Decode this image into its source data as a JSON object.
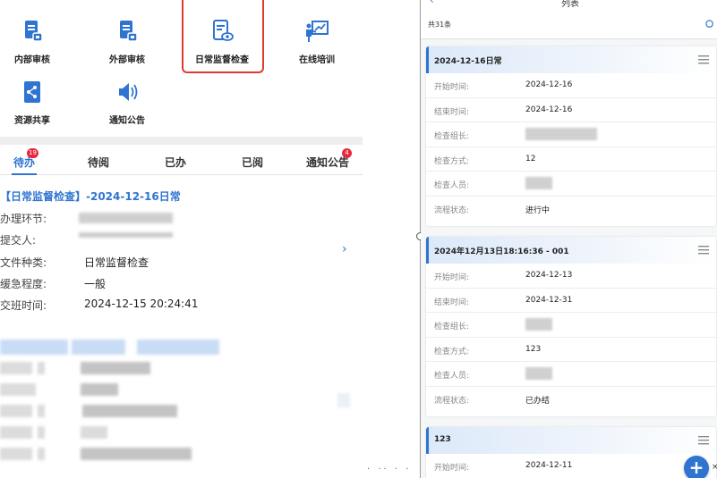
{
  "left": {
    "tiles": [
      {
        "label": "内部审核",
        "icon": "document-audit-icon"
      },
      {
        "label": "外部审核",
        "icon": "document-audit-icon"
      },
      {
        "label": "日常监督检查",
        "icon": "document-inspect-icon"
      },
      {
        "label": "在线培训",
        "icon": "presentation-board-icon"
      },
      {
        "label": "资源共享",
        "icon": "share-icon"
      },
      {
        "label": "通知公告",
        "icon": "megaphone-icon"
      }
    ],
    "tabs": [
      {
        "label": "待办",
        "badge": "19"
      },
      {
        "label": "待阅",
        "badge": ""
      },
      {
        "label": "已办",
        "badge": ""
      },
      {
        "label": "已阅",
        "badge": ""
      },
      {
        "label": "通知公告",
        "badge": "4"
      }
    ],
    "task": {
      "title": "【日常监督检查】-2024-12-16日常",
      "fields": [
        {
          "label": "办理环节:",
          "value": ""
        },
        {
          "label": "提交人:",
          "value": ""
        },
        {
          "label": "文件种类:",
          "value": "日常监督检查"
        },
        {
          "label": "缓急程度:",
          "value": "一般"
        },
        {
          "label": "交班时间:",
          "value": "2024-12-15 20:24:41"
        }
      ]
    }
  },
  "right": {
    "nav_title": "列表",
    "count_text": "共31条",
    "fab_label": "+",
    "close_glyph": "×",
    "cards": [
      {
        "title": "2024-12-16日常",
        "fields": [
          {
            "label": "开始时间:",
            "value": "2024-12-16"
          },
          {
            "label": "结束时间:",
            "value": "2024-12-16"
          },
          {
            "label": "检查组长:",
            "value": ""
          },
          {
            "label": "检查方式:",
            "value": "12"
          },
          {
            "label": "检查人员:",
            "value": ""
          },
          {
            "label": "流程状态:",
            "value": "进行中"
          }
        ]
      },
      {
        "title": "2024年12月13日18:16:36 - 001",
        "fields": [
          {
            "label": "开始时间:",
            "value": "2024-12-13"
          },
          {
            "label": "结束时间:",
            "value": "2024-12-31"
          },
          {
            "label": "检查组长:",
            "value": ""
          },
          {
            "label": "检查方式:",
            "value": "123"
          },
          {
            "label": "检查人员:",
            "value": ""
          },
          {
            "label": "流程状态:",
            "value": "已办结"
          }
        ]
      },
      {
        "title": "123",
        "fields": [
          {
            "label": "开始时间:",
            "value": "2024-12-11"
          }
        ]
      }
    ]
  },
  "colors": {
    "accent": "#2f74d0",
    "highlight_border": "#e03a2f",
    "badge": "#e5283c"
  }
}
